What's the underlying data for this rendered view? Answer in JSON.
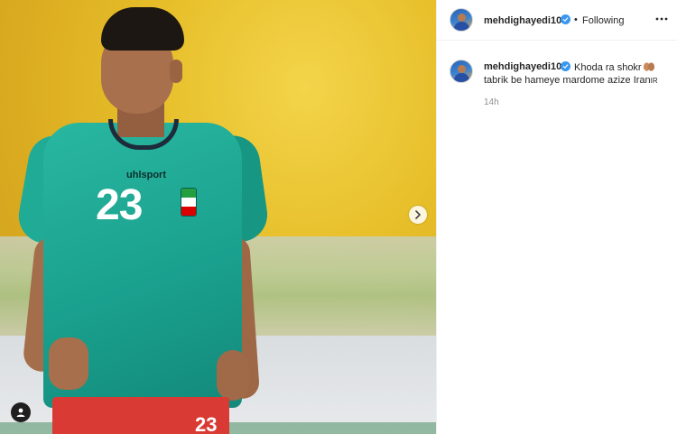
{
  "post": {
    "author": {
      "username": "mehdighayedi10",
      "verified": true
    },
    "follow_state": "Following",
    "separator": "•",
    "caption": {
      "username": "mehdighayedi10",
      "line1": "Khoda ra shokr",
      "line2": "tabrik be hameye mardome azize Iran",
      "flag_text": "IR",
      "emoji_name": "folded-hands-emoji"
    },
    "time_ago": "14h"
  },
  "media": {
    "jersey_brand": "uhlsport",
    "jersey_number": "23",
    "shorts_number": "23"
  },
  "colors": {
    "verified_blue": "#3897f0",
    "text": "#262626",
    "muted": "#8e8e8e",
    "divider": "#efefef"
  },
  "icons": {
    "next": "chevron-right-icon",
    "tag": "user-tag-icon",
    "more": "more-options-icon",
    "verified": "verified-badge-icon"
  }
}
